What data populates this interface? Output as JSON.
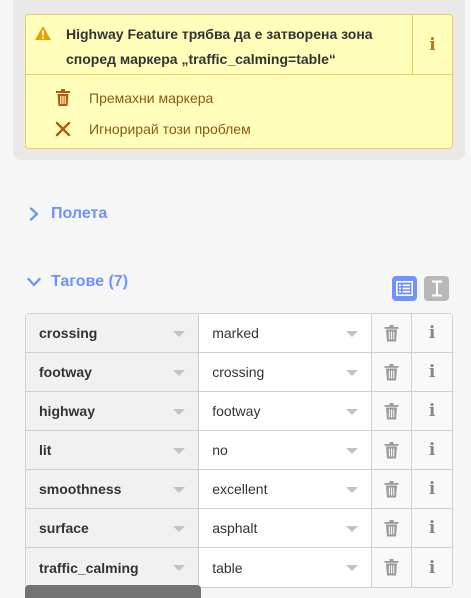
{
  "issue": {
    "message": "Highway Feature трябва да е затворена зона според маркера „traffic_calming=table“",
    "info_glyph": "i",
    "fixes": [
      {
        "label": "Премахни маркера",
        "icon": "trash-icon"
      },
      {
        "label": "Игнорирай този проблем",
        "icon": "close-icon"
      }
    ],
    "colors": {
      "background": "#ffffbb",
      "border": "#e8cf5a",
      "warning": "#e8a200",
      "fix_text": "#8a5a12"
    }
  },
  "sections": {
    "fields": {
      "label": "Полета",
      "expanded": false
    },
    "tags": {
      "label": "Тагове (7)",
      "expanded": true
    }
  },
  "tag_view": {
    "active": "list",
    "options": [
      "list-view-icon",
      "text-view-icon"
    ]
  },
  "tags": [
    {
      "key": "crossing",
      "value": "marked"
    },
    {
      "key": "footway",
      "value": "crossing"
    },
    {
      "key": "highway",
      "value": "footway"
    },
    {
      "key": "lit",
      "value": "no"
    },
    {
      "key": "smoothness",
      "value": "excellent"
    },
    {
      "key": "surface",
      "value": "asphalt"
    },
    {
      "key": "traffic_calming",
      "value": "table"
    }
  ],
  "row_info_glyph": "i",
  "accent": "#7092ff"
}
